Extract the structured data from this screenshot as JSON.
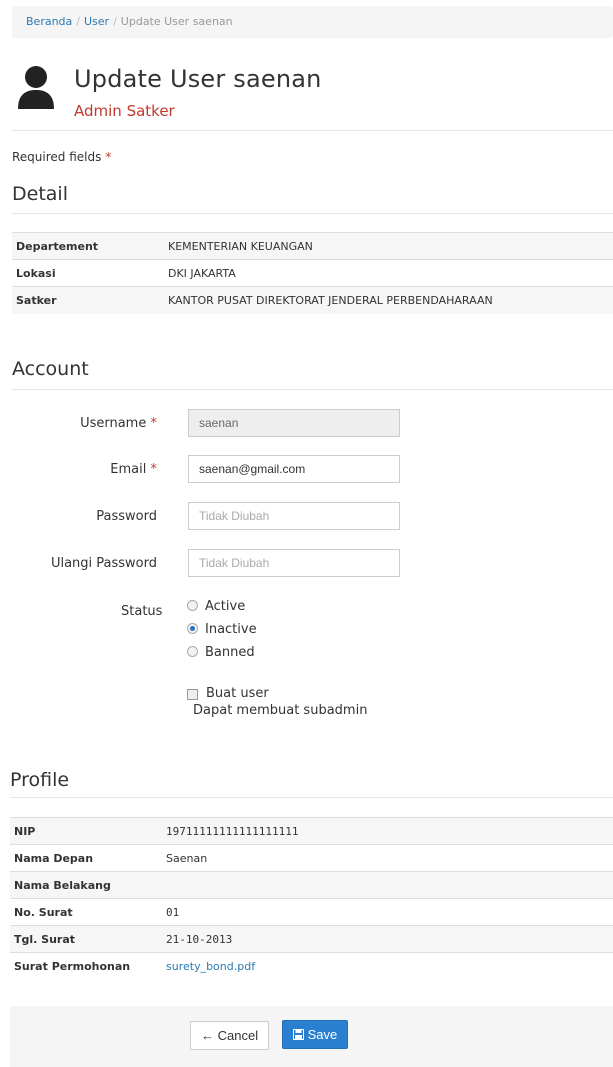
{
  "breadcrumb": {
    "home": "Beranda",
    "user": "User",
    "current": "Update User saenan",
    "sep": "/"
  },
  "header": {
    "title": "Update User saenan",
    "role": "Admin Satker"
  },
  "required": {
    "text": "Required fields",
    "star": "*"
  },
  "detail": {
    "title": "Detail",
    "rows": [
      {
        "key": "Departement",
        "value": "KEMENTERIAN KEUANGAN"
      },
      {
        "key": "Lokasi",
        "value": "DKI JAKARTA"
      },
      {
        "key": "Satker",
        "value": "KANTOR PUSAT DIREKTORAT JENDERAL PERBENDAHARAAN"
      }
    ]
  },
  "account": {
    "title": "Account",
    "username": {
      "label": "Username",
      "value": "saenan"
    },
    "email": {
      "label": "Email",
      "value": "saenan@gmail.com"
    },
    "password": {
      "label": "Password",
      "placeholder": "Tidak Diubah"
    },
    "repeat_password": {
      "label": "Ulangi Password",
      "placeholder": "Tidak Diubah"
    },
    "status": {
      "label": "Status",
      "options": [
        "Active",
        "Inactive",
        "Banned"
      ],
      "selected": "Inactive"
    },
    "create_user": {
      "label": "Buat user",
      "hint": "Dapat membuat subadmin",
      "checked": false
    }
  },
  "profile": {
    "title": "Profile",
    "rows": [
      {
        "key": "NIP",
        "value": "19711111111111111111"
      },
      {
        "key": "Nama Depan",
        "value": "Saenan"
      },
      {
        "key": "Nama Belakang",
        "value": ""
      },
      {
        "key": "No. Surat",
        "value": "01"
      },
      {
        "key": "Tgl. Surat",
        "value": "21-10-2013"
      },
      {
        "key": "Surat Permohonan",
        "value": "surety_bond.pdf"
      }
    ]
  },
  "buttons": {
    "cancel": "Cancel",
    "save": "Save"
  },
  "colors": {
    "accent": "#2b7fd0",
    "required": "#c0392b",
    "link": "#2a7ab0"
  },
  "icons": {
    "user": "user-icon",
    "cancel": "arrow-left-icon",
    "save": "floppy-disk-icon"
  }
}
